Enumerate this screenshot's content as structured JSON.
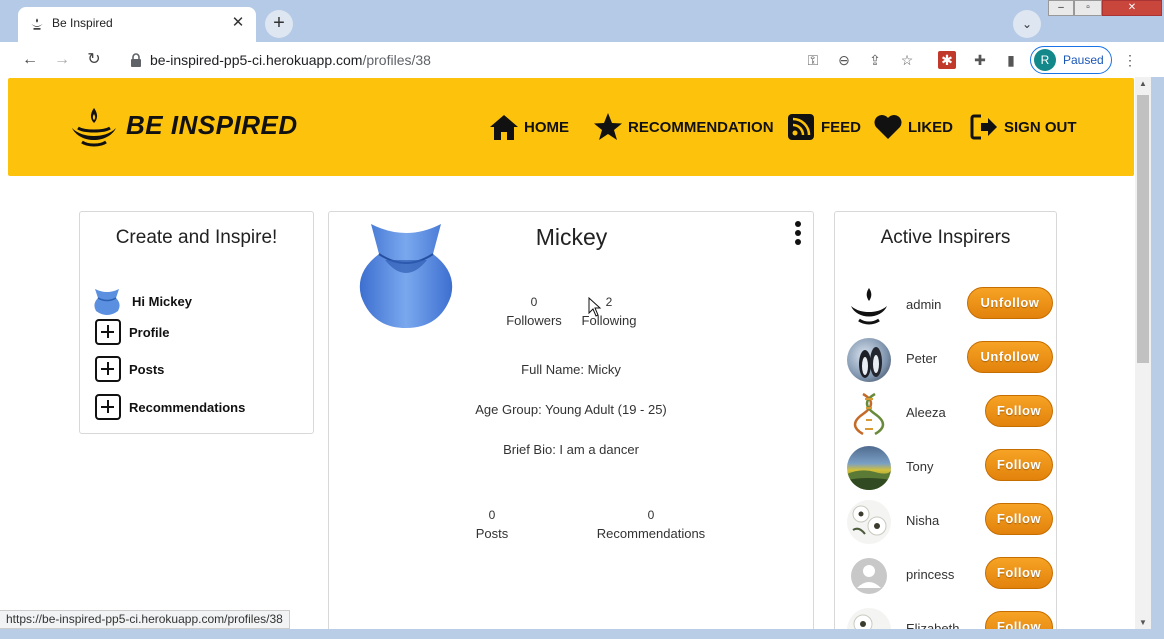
{
  "browser": {
    "tab_title": "Be Inspired",
    "tab_close": "✕",
    "new_tab": "+",
    "tab_search": "⌄",
    "url_host": "be-inspired-pp5-ci.herokuapp.com",
    "url_path": "/profiles/38",
    "profile_initial": "R",
    "profile_status": "Paused",
    "status_url": "https://be-inspired-pp5-ci.herokuapp.com/profiles/38",
    "window_controls": [
      "–",
      "▫",
      "✕"
    ]
  },
  "nav": {
    "brand": "BE INSPIRED",
    "items": [
      {
        "label": "HOME",
        "icon": "home-icon"
      },
      {
        "label": "RECOMMENDATION",
        "icon": "star-icon"
      },
      {
        "label": "FEED",
        "icon": "rss-icon"
      },
      {
        "label": "LIKED",
        "icon": "heart-icon"
      },
      {
        "label": "SIGN OUT",
        "icon": "sign-out-icon"
      }
    ]
  },
  "left_panel": {
    "title": "Create and Inspire!",
    "greeting": "Hi Mickey",
    "actions": [
      "Profile",
      "Posts",
      "Recommendations"
    ]
  },
  "profile": {
    "name": "Mickey",
    "followers_count": "0",
    "followers_label": "Followers",
    "following_count": "2",
    "following_label": "Following",
    "full_name": "Full Name: Micky",
    "age_group": "Age Group: Young Adult (19 - 25)",
    "bio": "Brief Bio: I am a dancer",
    "posts_count": "0",
    "posts_label": "Posts",
    "recommendations_count": "0",
    "recommendations_label": "Recommendations"
  },
  "right_panel": {
    "title": "Active Inspirers",
    "inspirers": [
      {
        "name": "admin",
        "button": "Unfollow"
      },
      {
        "name": "Peter",
        "button": "Unfollow"
      },
      {
        "name": "Aleeza",
        "button": "Follow"
      },
      {
        "name": "Tony",
        "button": "Follow"
      },
      {
        "name": "Nisha",
        "button": "Follow"
      },
      {
        "name": "princess",
        "button": "Follow"
      },
      {
        "name": "Elizabeth",
        "button": "Follow"
      }
    ]
  },
  "colors": {
    "navbar": "#fdc20c",
    "button": "#f39a1e",
    "avatar_blue": "#4a86e8"
  }
}
